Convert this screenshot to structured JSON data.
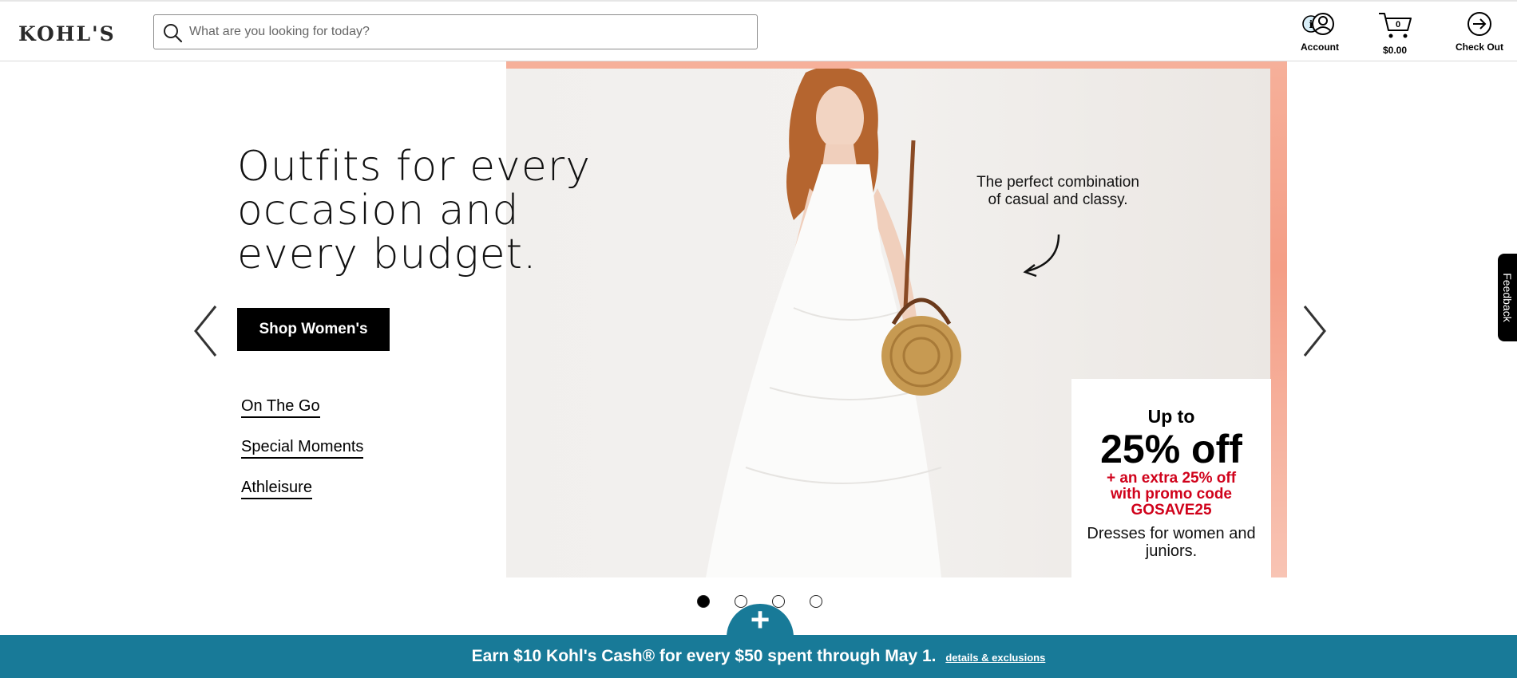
{
  "header": {
    "logo": "KOHL'S",
    "search": {
      "placeholder": "What are you looking for today?",
      "value": ""
    },
    "account_label": "Account",
    "cart_label": "$0.00",
    "cart_count": "0",
    "checkout_label": "Check Out"
  },
  "hero": {
    "headline": "Outfits for every occasion and every budget.",
    "shop_button": "Shop Women's",
    "links": [
      "On The Go",
      "Special Moments",
      "Athleisure"
    ],
    "tagline": "The perfect combination of casual and classy.",
    "promo": {
      "upto": "Up to",
      "discount": "25% off",
      "extra_line1": "+ an extra 25% off",
      "extra_line2": "with promo code",
      "code": "GOSAVE25",
      "description": "Dresses for women and juniors."
    },
    "slides": {
      "count": 4,
      "active": 1
    }
  },
  "banner": {
    "text": "Earn $10 Kohl's Cash® for every $50 spent through May 1.",
    "details_link": "details & exclusions"
  },
  "feedback_label": "Feedback",
  "icons": {
    "search": "search-icon",
    "account": "account-icon",
    "cart": "cart-icon",
    "checkout": "checkout-arrow-icon",
    "prev": "chevron-left-icon",
    "next": "chevron-right-icon",
    "plus": "plus-icon"
  },
  "colors": {
    "accent_teal": "#187a98",
    "promo_red": "#d0021b",
    "hero_frame": "#f49e86"
  }
}
